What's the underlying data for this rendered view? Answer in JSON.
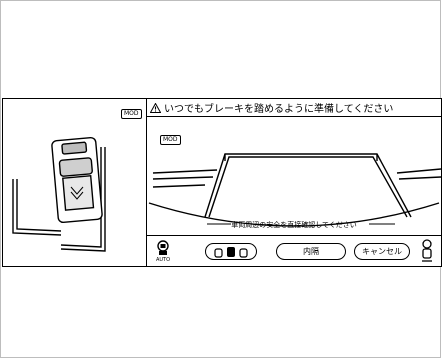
{
  "left_view": {
    "mod_label": "MOD"
  },
  "warning": {
    "text": "いつでもブレーキを踏めるように準備してください"
  },
  "camera": {
    "mod_label": "MOD",
    "guide_text": "車両周辺の安全を直接確認してください"
  },
  "controls": {
    "auto_label": "AUTO",
    "inner_label": "内隔",
    "cancel_label": "キャンセル"
  },
  "icons": {
    "warning": "warning-triangle-icon",
    "camera_switch": "camera-switch-icon",
    "view_mode": "view-mode-icon",
    "sensor": "sensor-person-icon"
  }
}
